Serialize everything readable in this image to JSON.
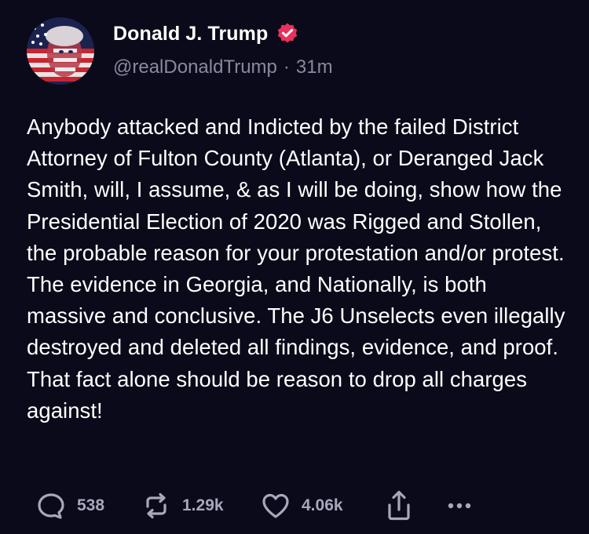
{
  "post": {
    "author": {
      "display_name": "Donald J. Trump",
      "handle": "@realDonaldTrump",
      "separator": "·",
      "time": "31m",
      "verified_icon": "verified-badge-icon",
      "verified_color": "#e8315b"
    },
    "body": "Anybody attacked and Indicted by the failed District Attorney of Fulton County (Atlanta), or Deranged Jack Smith, will, I assume, & as I will be doing, show how the Presidential Election of 2020 was Rigged and Stollen, the probable reason for your protestation and/or protest. The evidence in Georgia, and Nationally, is both massive and conclusive. The J6 Unselects even illegally destroyed and deleted all findings, evidence, and proof. That fact alone should be reason to drop all charges against!",
    "actions": {
      "reply_count": "538",
      "retruth_count": "1.29k",
      "like_count": "4.06k",
      "reply_icon": "comment-bubble-icon",
      "retruth_icon": "repost-arrows-icon",
      "like_icon": "heart-icon",
      "share_icon": "share-upload-icon",
      "more_icon": "more-dots-icon"
    }
  },
  "colors": {
    "background": "#0b0a1a",
    "text": "#ffffff",
    "secondary_text": "#8a889e",
    "action_text": "#a9a7bb",
    "accent": "#e8315b"
  }
}
